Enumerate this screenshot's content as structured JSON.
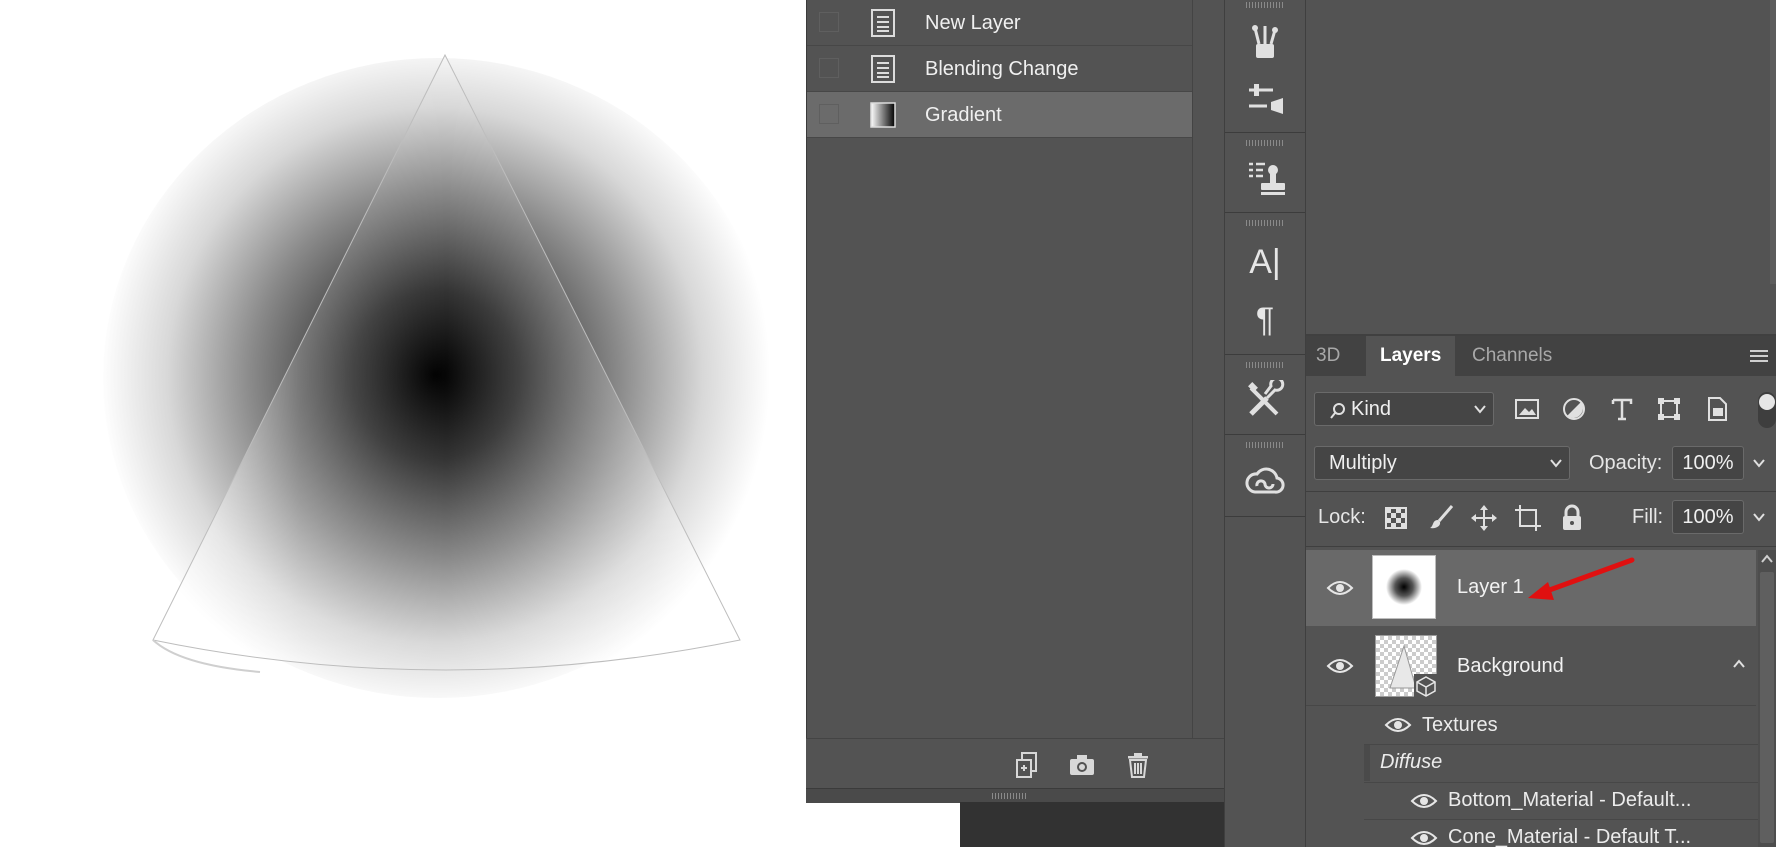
{
  "history": {
    "items": [
      {
        "label": "New Layer",
        "icon": "document-icon",
        "selected": false
      },
      {
        "label": "Blending Change",
        "icon": "document-icon",
        "selected": false
      },
      {
        "label": "Gradient",
        "icon": "gradient-icon",
        "selected": true
      }
    ],
    "footer_icons": [
      "new-document-from-state-icon",
      "camera-snapshot-icon",
      "trash-icon"
    ]
  },
  "toolstrip": {
    "tools": [
      "brushes-tool-icon",
      "brush-settings-icon",
      "clone-source-icon",
      "character-icon",
      "paragraph-icon",
      "tools-icon",
      "creative-cloud-libraries-icon"
    ],
    "character_label": "A|",
    "paragraph_label": "¶"
  },
  "layers_panel": {
    "tabs": [
      {
        "label": "3D",
        "active": false
      },
      {
        "label": "Layers",
        "active": true
      },
      {
        "label": "Channels",
        "active": false
      }
    ],
    "filter": {
      "value": "Kind",
      "icon": "search-icon"
    },
    "filter_icons": [
      "image-filter-icon",
      "adjustment-filter-icon",
      "type-filter-icon",
      "shape-filter-icon",
      "smart-object-filter-icon"
    ],
    "blend_mode": "Multiply",
    "opacity_label": "Opacity:",
    "opacity_value": "100%",
    "lock_label": "Lock:",
    "lock_icons": [
      "lock-transparent-icon",
      "lock-pixels-icon",
      "lock-position-icon",
      "lock-artboard-icon",
      "lock-all-icon"
    ],
    "fill_label": "Fill:",
    "fill_value": "100%",
    "layers": [
      {
        "name": "Layer 1",
        "selected": true,
        "visible": true
      },
      {
        "name": "Background",
        "selected": false,
        "visible": true
      }
    ],
    "sub_items": {
      "textures_label": "Textures",
      "diffuse_label": "Diffuse",
      "materials": [
        "Bottom_Material - Default...",
        "Cone_Material - Default T..."
      ]
    }
  },
  "colors": {
    "panel": "#535353",
    "panel_dark": "#424242",
    "selected_row": "#6b6b6b",
    "annotation_arrow": "#e01010"
  }
}
